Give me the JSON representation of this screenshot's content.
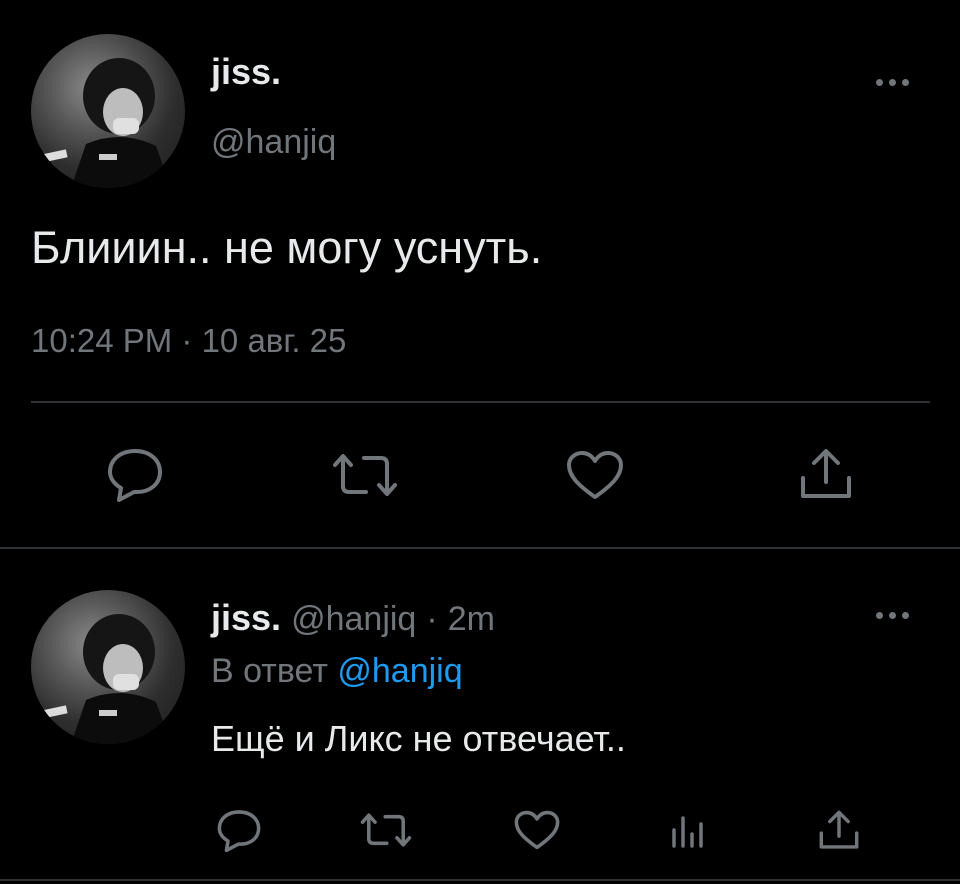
{
  "main_tweet": {
    "display_name": "jiss.",
    "handle": "@hanjiq",
    "text": "Блииин.. не могу уснуть.",
    "timestamp": "10:24 PM · 10 авг. 25",
    "actions": [
      "reply-icon",
      "retweet-icon",
      "like-icon",
      "share-icon"
    ]
  },
  "reply_tweet": {
    "display_name": "jiss.",
    "handle": "@hanjiq",
    "separator": "·",
    "time": "2m",
    "reply_prefix": "В ответ",
    "reply_to": "@hanjiq",
    "text": "Ещё и Ликс не отвечает..",
    "actions": [
      "reply-icon",
      "retweet-icon",
      "like-icon",
      "analytics-icon",
      "share-icon"
    ]
  },
  "colors": {
    "background": "#000000",
    "text": "#e7e9ea",
    "secondary": "#71767b",
    "link": "#1d9bf0",
    "divider": "#2f3336"
  }
}
